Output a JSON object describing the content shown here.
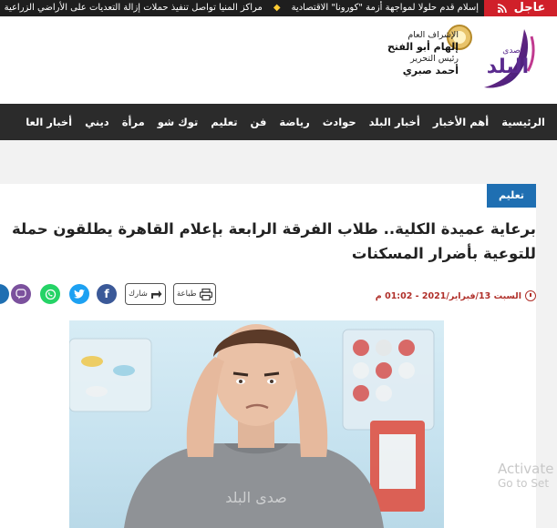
{
  "ticker": {
    "badge": "عاجل",
    "items": [
      "إسلام قدم حلولا لمواجهة أزمة \"كورونا\" الاقتصادية",
      "مراكز المنيا تواصل تنفيذ حملات إزالة التعديات على الأراضي الزراعية"
    ]
  },
  "brand": {
    "logo_text": "البلد",
    "logo_small": "صدى"
  },
  "staff": {
    "supervision_label": "الإشراف العام",
    "supervisor_name": "إلهام أبو الفتح",
    "editor_label": "رئيس التحرير",
    "editor_name": "أحمد صبري"
  },
  "nav": {
    "items": [
      "الرئيسية",
      "أهم الأخبار",
      "أخبار البلد",
      "حوادث",
      "رياضة",
      "فن",
      "تعليم",
      "توك شو",
      "مرأة",
      "ديني",
      "أخبار العا"
    ]
  },
  "article": {
    "category": "تعليم",
    "headline": "برعاية عميدة الكلية.. طلاب الفرقة الرابعة بإعلام القاهرة يطلقون حملة للتوعية بأضرار المسكنات",
    "date": "السبت 13/فبراير/2021 - 01:02 م",
    "print_label": "طباعة",
    "share_label": "شارك",
    "image_watermark": "صدى البلد"
  },
  "share_icons": [
    "facebook-icon",
    "twitter-icon",
    "whatsapp-icon",
    "viber-icon"
  ],
  "windows_watermark": {
    "line1": "Activate",
    "line2": "Go to Set"
  },
  "colors": {
    "breaking": "#d0202a",
    "nav_bg": "#2b2b2b",
    "category": "#1f6fb2",
    "facebook": "#3b5998",
    "twitter": "#1da1f2",
    "whatsapp": "#25d366",
    "viber": "#7b519d"
  }
}
